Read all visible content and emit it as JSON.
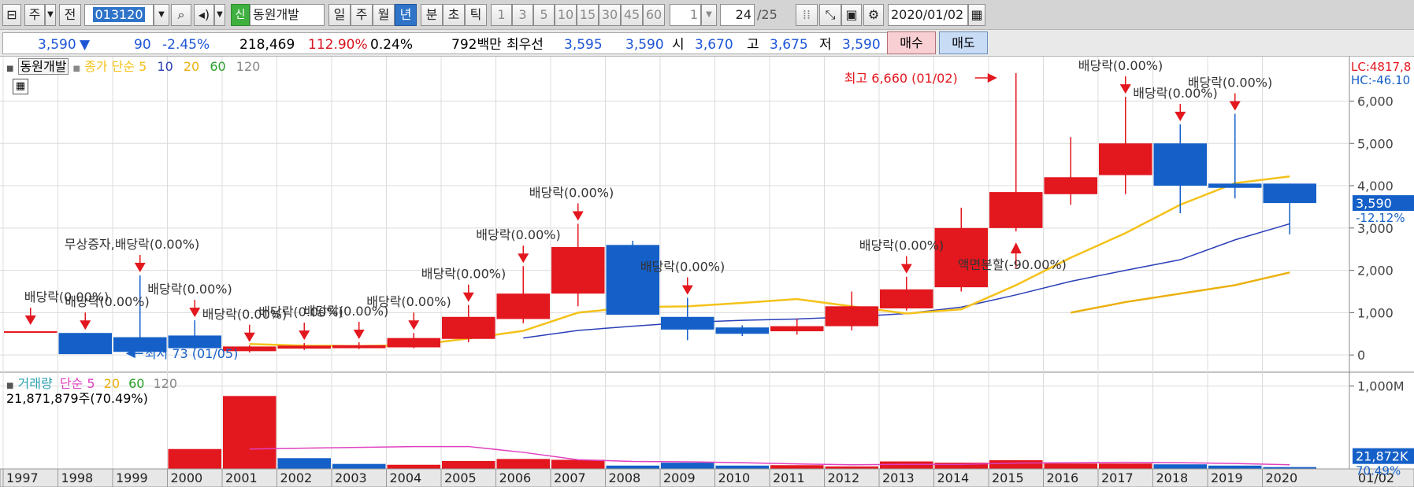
{
  "toolbar": {
    "type_label": "주",
    "all_label": "전",
    "code": "013120",
    "sin_badge": "신",
    "stock_name": "동원개발",
    "periods": [
      "일",
      "주",
      "월",
      "년",
      "분",
      "초",
      "틱"
    ],
    "active_period": "년",
    "intervals": [
      "1",
      "3",
      "5",
      "10",
      "15",
      "30",
      "45",
      "60"
    ],
    "interval_value": "1",
    "page_value": "24",
    "page_total": "/25",
    "date": "2020/01/02"
  },
  "quote": {
    "price": "3,590",
    "arrow": "▼",
    "change": "90",
    "change_pct": "-2.45%",
    "volume": "218,469",
    "volume_ratio": "112.90%",
    "turnover": "0.24%",
    "amount": "792백만",
    "best_label": "최우선",
    "best_ask": "3,595",
    "best_bid": "3,590",
    "open_label": "시",
    "open": "3,670",
    "high_label": "고",
    "high": "3,675",
    "low_label": "저",
    "low": "3,590",
    "buy_label": "매수",
    "sell_label": "매도"
  },
  "legend": {
    "stock": "동원개발",
    "ma_label": "종가 단순",
    "ma_periods": [
      "5",
      "10",
      "20",
      "60",
      "120"
    ],
    "vol_label": "거래량",
    "vol_ma_label": "단순",
    "vol_ma_periods": [
      "5",
      "20",
      "60",
      "120"
    ],
    "vol_current": "21,871,879주(70.49%)"
  },
  "colors": {
    "up": "#e3171e",
    "down": "#1560c8",
    "ma5": "#f4c21a",
    "ma10": "#2a3fb8",
    "ma20": "#ebb00e",
    "vol_ma5": "#e040c0",
    "grid": "#dcdcdc"
  },
  "chart_data": [
    {
      "type": "candlestick",
      "panel": "price",
      "categories": [
        "1997",
        "1998",
        "1999",
        "2000",
        "2001",
        "2002",
        "2003",
        "2004",
        "2005",
        "2006",
        "2007",
        "2008",
        "2009",
        "2010",
        "2011",
        "2012",
        "2013",
        "2014",
        "2015",
        "2016",
        "2017",
        "2018",
        "2019",
        "2020"
      ],
      "candles": [
        {
          "o": 560,
          "h": 560,
          "l": 560,
          "c": 560
        },
        {
          "o": 520,
          "h": 520,
          "l": 20,
          "c": 20
        },
        {
          "o": 420,
          "h": 1880,
          "l": 73,
          "c": 73
        },
        {
          "o": 460,
          "h": 820,
          "l": 130,
          "c": 160
        },
        {
          "o": 90,
          "h": 230,
          "l": 60,
          "c": 200
        },
        {
          "o": 150,
          "h": 280,
          "l": 120,
          "c": 220
        },
        {
          "o": 160,
          "h": 300,
          "l": 140,
          "c": 230
        },
        {
          "o": 180,
          "h": 520,
          "l": 160,
          "c": 400
        },
        {
          "o": 380,
          "h": 1180,
          "l": 300,
          "c": 900
        },
        {
          "o": 850,
          "h": 2100,
          "l": 750,
          "c": 1450
        },
        {
          "o": 1450,
          "h": 3100,
          "l": 1150,
          "c": 2550
        },
        {
          "o": 2600,
          "h": 2700,
          "l": 950,
          "c": 950
        },
        {
          "o": 900,
          "h": 1350,
          "l": 350,
          "c": 600
        },
        {
          "o": 650,
          "h": 700,
          "l": 450,
          "c": 500
        },
        {
          "o": 560,
          "h": 850,
          "l": 480,
          "c": 680
        },
        {
          "o": 680,
          "h": 1500,
          "l": 580,
          "c": 1150
        },
        {
          "o": 1100,
          "h": 1850,
          "l": 1050,
          "c": 1550
        },
        {
          "o": 1600,
          "h": 3480,
          "l": 1500,
          "c": 3000
        },
        {
          "o": 3000,
          "h": 6660,
          "l": 2920,
          "c": 3850
        },
        {
          "o": 3800,
          "h": 5150,
          "l": 3550,
          "c": 4200
        },
        {
          "o": 4250,
          "h": 6100,
          "l": 3800,
          "c": 5000
        },
        {
          "o": 5000,
          "h": 5450,
          "l": 3350,
          "c": 4000
        },
        {
          "o": 4050,
          "h": 5700,
          "l": 3700,
          "c": 3950
        },
        {
          "o": 4050,
          "h": 4050,
          "l": 2850,
          "c": 3590
        }
      ],
      "ma5": [
        null,
        null,
        null,
        null,
        260,
        220,
        210,
        230,
        390,
        570,
        1000,
        1130,
        1150,
        1230,
        1320,
        1150,
        980,
        1080,
        1650,
        2300,
        2880,
        3550,
        4060,
        4220
      ],
      "ma10": [
        null,
        null,
        null,
        null,
        null,
        null,
        null,
        null,
        null,
        400,
        580,
        680,
        770,
        820,
        850,
        900,
        980,
        1130,
        1420,
        1740,
        2000,
        2250,
        2720,
        3100
      ],
      "ma20": [
        null,
        null,
        null,
        null,
        null,
        null,
        null,
        null,
        null,
        null,
        null,
        null,
        null,
        null,
        null,
        null,
        null,
        null,
        null,
        1000,
        1250,
        1450,
        1650,
        1950
      ],
      "ylim": [
        -350,
        7050
      ],
      "y_ticks": [
        0,
        1000,
        2000,
        3000,
        4000,
        5000,
        6000
      ],
      "y_tick_labels": [
        "0",
        "1,000",
        "2,000",
        "3,000",
        "4,000",
        "5,000",
        "6,000"
      ],
      "last_price": "3,590",
      "last_change": "-12.12%",
      "lc": "LC:4817,8",
      "hc": "HC:-46.10",
      "high_annotation": "최고 6,660 (01/02)",
      "low_annotation": "최저 73 (01/05)",
      "events": [
        {
          "text": "배당락(0.00%)",
          "x": "1997"
        },
        {
          "text": "배당락(0.00%)",
          "x": "1998"
        },
        {
          "text": "무상증자,배당락(0.00%)",
          "x": "1999"
        },
        {
          "text": "배당락(0.00%)",
          "x": "2000"
        },
        {
          "text": "배당락(0.00%)",
          "x": "2001"
        },
        {
          "text": "배당락(0.00%)",
          "x": "2002"
        },
        {
          "text": "배당락(0.00%)",
          "x": "2003"
        },
        {
          "text": "배당락(0.00%)",
          "x": "2004"
        },
        {
          "text": "배당락(0.00%)",
          "x": "2005"
        },
        {
          "text": "배당락(0.00%)",
          "x": "2006"
        },
        {
          "text": "배당락(0.00%)",
          "x": "2007"
        },
        {
          "text": "배당락(0.00%)",
          "x": "2009"
        },
        {
          "text": "배당락(0.00%)",
          "x": "2013"
        },
        {
          "text": "액면분할(-90.00%)",
          "x": "2015"
        },
        {
          "text": "배당락(0.00%)",
          "x": "2017"
        },
        {
          "text": "배당락(0.00%)",
          "x": "2018"
        },
        {
          "text": "배당락(0.00%)",
          "x": "2019"
        }
      ]
    },
    {
      "type": "bar",
      "panel": "volume",
      "categories": [
        "1997",
        "1998",
        "1999",
        "2000",
        "2001",
        "2002",
        "2003",
        "2004",
        "2005",
        "2006",
        "2007",
        "2008",
        "2009",
        "2010",
        "2011",
        "2012",
        "2013",
        "2014",
        "2015",
        "2016",
        "2017",
        "2018",
        "2019",
        "2020"
      ],
      "values": [
        0.5,
        1,
        3,
        240,
        880,
        130,
        60,
        50,
        95,
        120,
        110,
        40,
        75,
        40,
        45,
        30,
        90,
        75,
        105,
        65,
        65,
        55,
        40,
        22
      ],
      "directions": [
        "down",
        "down",
        "down",
        "up",
        "up",
        "down",
        "down",
        "up",
        "up",
        "up",
        "up",
        "down",
        "down",
        "down",
        "up",
        "up",
        "up",
        "up",
        "up",
        "up",
        "up",
        "down",
        "down",
        "down"
      ],
      "vol_ma5": [
        null,
        null,
        null,
        null,
        240,
        250,
        260,
        270,
        270,
        200,
        110,
        90,
        85,
        75,
        60,
        50,
        55,
        55,
        70,
        75,
        80,
        75,
        65,
        50
      ],
      "ylim": [
        0,
        1130
      ],
      "y_ticks": [
        1000
      ],
      "y_tick_labels": [
        "1,000M"
      ],
      "last_value": "21,872K",
      "last_ratio": "70.49%",
      "date_label": "01/02"
    }
  ]
}
